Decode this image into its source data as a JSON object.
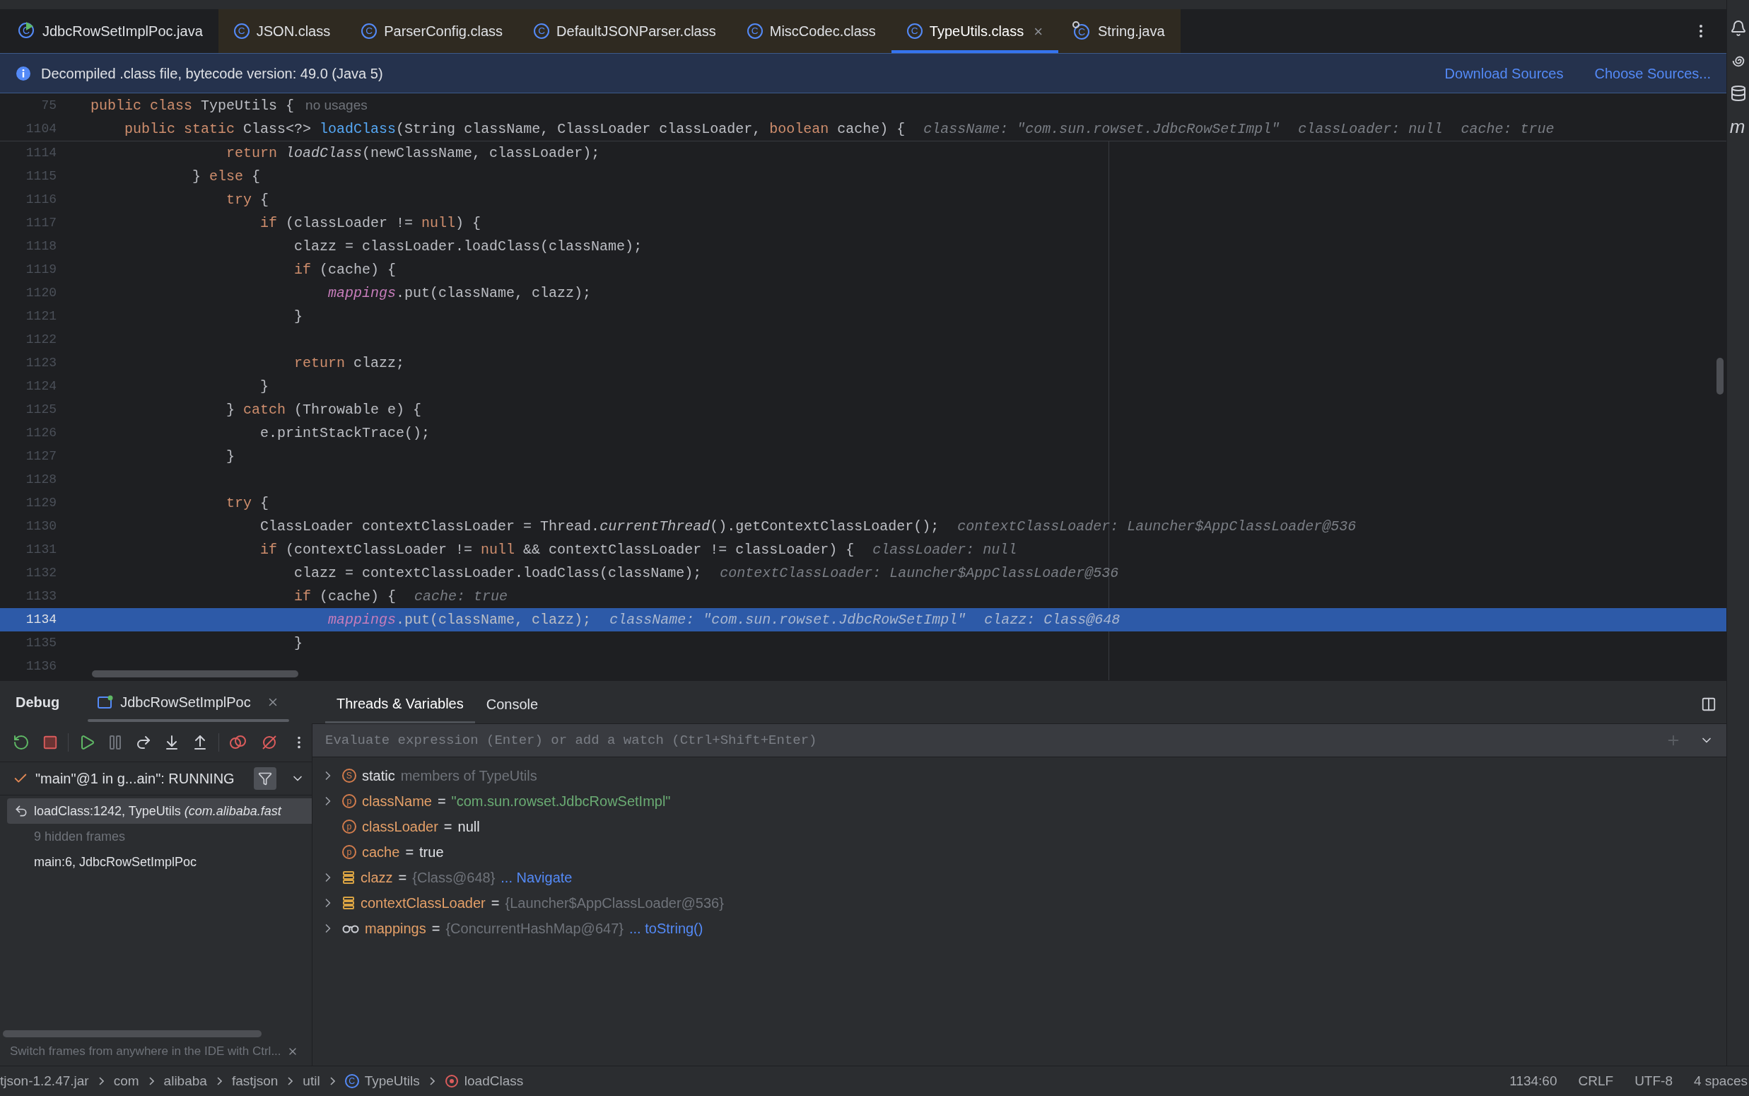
{
  "tabs": [
    {
      "label": "JdbcRowSetImplPoc.java",
      "kind": "project-source",
      "badge": "C",
      "selected": false,
      "closable": false
    },
    {
      "label": "JSON.class",
      "kind": "library-class",
      "badge": "C",
      "selected": false,
      "closable": false
    },
    {
      "label": "ParserConfig.class",
      "kind": "library-class",
      "badge": "C",
      "selected": false,
      "closable": false
    },
    {
      "label": "DefaultJSONParser.class",
      "kind": "library-class",
      "badge": "C",
      "selected": false,
      "closable": false
    },
    {
      "label": "MiscCodec.class",
      "kind": "library-class",
      "badge": "C",
      "selected": false,
      "closable": false
    },
    {
      "label": "TypeUtils.class",
      "kind": "library-class",
      "badge": "C",
      "selected": true,
      "closable": true
    },
    {
      "label": "String.java",
      "kind": "library-source",
      "badge": "C",
      "selected": false,
      "closable": false
    }
  ],
  "close_glyph": "×",
  "info_bar": {
    "message": "Decompiled .class file, bytecode version: 49.0 (Java 5)",
    "links": [
      "Download Sources",
      "Choose Sources..."
    ]
  },
  "sticky_lines": [
    {
      "number": "75",
      "tokens": [
        {
          "kind": "keyword",
          "text": "public class "
        },
        {
          "kind": "plain",
          "text": "TypeUtils {"
        },
        {
          "kind": "inlay",
          "text": "no usages"
        }
      ]
    },
    {
      "number": "1104",
      "tokens": [
        {
          "kind": "keyword",
          "text": "    public static "
        },
        {
          "kind": "plain",
          "text": "Class<?> "
        },
        {
          "kind": "method",
          "text": "loadClass"
        },
        {
          "kind": "plain",
          "text": "(String className, ClassLoader classLoader, "
        },
        {
          "kind": "keyword",
          "text": "boolean"
        },
        {
          "kind": "plain",
          "text": " cache) {"
        },
        {
          "kind": "hint",
          "text": "className: \"com.sun.rowset.JdbcRowSetImpl\""
        },
        {
          "kind": "hint",
          "text": "classLoader: null"
        },
        {
          "kind": "hint",
          "text": "cache: true"
        }
      ]
    }
  ],
  "code_lines": [
    {
      "number": "1114",
      "current": false,
      "tokens": [
        {
          "kind": "keyword",
          "text": "                return "
        },
        {
          "kind": "static-call",
          "text": "loadClass"
        },
        {
          "kind": "plain",
          "text": "(newClassName, classLoader);"
        }
      ]
    },
    {
      "number": "1115",
      "current": false,
      "tokens": [
        {
          "kind": "plain",
          "text": "            } "
        },
        {
          "kind": "keyword",
          "text": "else"
        },
        {
          "kind": "plain",
          "text": " {"
        }
      ]
    },
    {
      "number": "1116",
      "current": false,
      "tokens": [
        {
          "kind": "keyword",
          "text": "                try"
        },
        {
          "kind": "plain",
          "text": " {"
        }
      ]
    },
    {
      "number": "1117",
      "current": false,
      "tokens": [
        {
          "kind": "keyword",
          "text": "                    if"
        },
        {
          "kind": "plain",
          "text": " (classLoader != "
        },
        {
          "kind": "keyword",
          "text": "null"
        },
        {
          "kind": "plain",
          "text": ") {"
        }
      ]
    },
    {
      "number": "1118",
      "current": false,
      "tokens": [
        {
          "kind": "plain",
          "text": "                        clazz = classLoader.loadClass(className);"
        }
      ]
    },
    {
      "number": "1119",
      "current": false,
      "tokens": [
        {
          "kind": "keyword",
          "text": "                        if"
        },
        {
          "kind": "plain",
          "text": " (cache) {"
        }
      ]
    },
    {
      "number": "1120",
      "current": false,
      "tokens": [
        {
          "kind": "field",
          "text": "                            mappings"
        },
        {
          "kind": "plain",
          "text": ".put(className, clazz);"
        }
      ]
    },
    {
      "number": "1121",
      "current": false,
      "tokens": [
        {
          "kind": "plain",
          "text": "                        }"
        }
      ]
    },
    {
      "number": "1122",
      "current": false
    },
    {
      "number": "1123",
      "current": false,
      "tokens": [
        {
          "kind": "keyword",
          "text": "                        return"
        },
        {
          "kind": "plain",
          "text": " clazz;"
        }
      ]
    },
    {
      "number": "1124",
      "current": false,
      "tokens": [
        {
          "kind": "plain",
          "text": "                    }"
        }
      ]
    },
    {
      "number": "1125",
      "current": false,
      "tokens": [
        {
          "kind": "plain",
          "text": "                } "
        },
        {
          "kind": "keyword",
          "text": "catch"
        },
        {
          "kind": "plain",
          "text": " (Throwable e) {"
        }
      ]
    },
    {
      "number": "1126",
      "current": false,
      "tokens": [
        {
          "kind": "plain",
          "text": "                    e.printStackTrace();"
        }
      ]
    },
    {
      "number": "1127",
      "current": false,
      "tokens": [
        {
          "kind": "plain",
          "text": "                }"
        }
      ]
    },
    {
      "number": "1128",
      "current": false
    },
    {
      "number": "1129",
      "current": false,
      "tokens": [
        {
          "kind": "keyword",
          "text": "                try"
        },
        {
          "kind": "plain",
          "text": " {"
        }
      ]
    },
    {
      "number": "1130",
      "current": false,
      "tokens": [
        {
          "kind": "plain",
          "text": "                    ClassLoader contextClassLoader = Thread."
        },
        {
          "kind": "static-call",
          "text": "currentThread"
        },
        {
          "kind": "plain",
          "text": "().getContextClassLoader();"
        },
        {
          "kind": "hint",
          "text": "contextClassLoader: Launcher$AppClassLoader@536"
        }
      ]
    },
    {
      "number": "1131",
      "current": false,
      "tokens": [
        {
          "kind": "keyword",
          "text": "                    if"
        },
        {
          "kind": "plain",
          "text": " (contextClassLoader != "
        },
        {
          "kind": "keyword",
          "text": "null"
        },
        {
          "kind": "plain",
          "text": " && contextClassLoader != classLoader) {"
        },
        {
          "kind": "hint",
          "text": "classLoader: null"
        }
      ]
    },
    {
      "number": "1132",
      "current": false,
      "tokens": [
        {
          "kind": "plain",
          "text": "                        clazz = contextClassLoader.loadClass(className);"
        },
        {
          "kind": "hint",
          "text": "contextClassLoader: Launcher$AppClassLoader@536"
        }
      ]
    },
    {
      "number": "1133",
      "current": false,
      "tokens": [
        {
          "kind": "keyword",
          "text": "                        if"
        },
        {
          "kind": "plain",
          "text": " (cache) {"
        },
        {
          "kind": "hint",
          "text": "cache: true"
        }
      ]
    },
    {
      "number": "1134",
      "current": true,
      "tokens": [
        {
          "kind": "field",
          "text": "                            mappings"
        },
        {
          "kind": "plain",
          "text": ".put(className, clazz);"
        },
        {
          "kind": "hint",
          "text": "className: \"com.sun.rowset.JdbcRowSetImpl\""
        },
        {
          "kind": "hint",
          "text": "clazz: Class@648"
        }
      ]
    },
    {
      "number": "1135",
      "current": false,
      "tokens": [
        {
          "kind": "plain",
          "text": "                        }"
        }
      ]
    },
    {
      "number": "1136",
      "current": false
    }
  ],
  "debug": {
    "title": "Debug",
    "session_tab": {
      "label": "JdbcRowSetImplPoc",
      "selected": true
    },
    "view_tabs": [
      {
        "label": "Threads & Variables",
        "selected": true
      },
      {
        "label": "Console",
        "selected": false
      }
    ],
    "thread": "\"main\"@1 in g...ain\": RUNNING",
    "frames": [
      {
        "kind": "frame",
        "text": "loadClass:1242, TypeUtils *(com.alibaba.fast*",
        "selected": true
      },
      {
        "kind": "hidden",
        "text": "9 hidden frames",
        "selected": false
      },
      {
        "kind": "frame",
        "text": "main:6, JdbcRowSetImplPoc",
        "selected": false
      }
    ],
    "evaluate_placeholder": "Evaluate expression (Enter) or add a watch (Ctrl+Shift+Enter)",
    "variables": [
      {
        "kind": "static",
        "badge": "S",
        "expandable": true,
        "name": "static",
        "value": "members of TypeUtils",
        "color": "#6f737a"
      },
      {
        "kind": "parameter",
        "badge": "p",
        "expandable": true,
        "name": "className",
        "operator": "=",
        "value": "\"com.sun.rowset.JdbcRowSetImpl\"",
        "color": "#6aab73"
      },
      {
        "kind": "parameter",
        "badge": "p",
        "expandable": false,
        "name": "classLoader",
        "operator": "=",
        "value": "null",
        "color": "#dfe1e5"
      },
      {
        "kind": "parameter",
        "badge": "p",
        "expandable": false,
        "name": "cache",
        "operator": "=",
        "value": "true",
        "color": "#dfe1e5"
      },
      {
        "kind": "local",
        "expandable": true,
        "name": "clazz",
        "operator": "=",
        "value": "{Class@648}",
        "color": "#6f737a",
        "link": "... Navigate"
      },
      {
        "kind": "local",
        "expandable": true,
        "name": "contextClassLoader",
        "operator": "=",
        "value": "{Launcher$AppClassLoader@536}",
        "color": "#6f737a"
      },
      {
        "kind": "field",
        "expandable": true,
        "name": "mappings",
        "operator": "=",
        "value": "{ConcurrentHashMap@647}",
        "color": "#6f737a",
        "link": "... toString()"
      }
    ],
    "hint": "Switch frames from anywhere in the IDE with Ctrl..."
  },
  "right_toolbar_letter": "m",
  "status_bar": {
    "breadcrumbs": [
      {
        "kind": "jar",
        "text": "tjson-1.2.47.jar"
      },
      {
        "kind": "package",
        "text": "com"
      },
      {
        "kind": "package",
        "text": "alibaba"
      },
      {
        "kind": "package",
        "text": "fastjson"
      },
      {
        "kind": "package",
        "text": "util"
      },
      {
        "kind": "class",
        "text": "TypeUtils",
        "badge": "C"
      },
      {
        "kind": "method",
        "text": "loadClass"
      }
    ],
    "items": [
      "1134:60",
      "CRLF",
      "UTF-8",
      "4 spaces"
    ]
  }
}
